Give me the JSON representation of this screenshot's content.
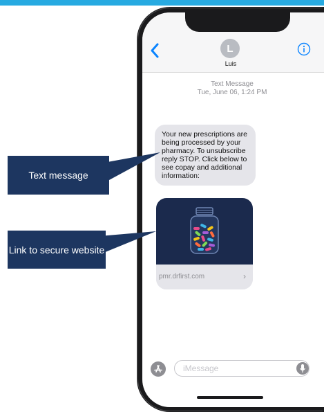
{
  "contact": {
    "initial": "L",
    "name": "Luis"
  },
  "conversation": {
    "type_label": "Text Message",
    "timestamp": "Tue, June 06, 1:24 PM",
    "message_text": "Your new prescriptions are being processed by your pharmacy. To unsubscribe reply STOP. Click below to see copay and additional information:",
    "link_url": "pmr.drfirst.com"
  },
  "composer": {
    "placeholder": "iMessage"
  },
  "callouts": {
    "text_message": "Text message",
    "secure_link": "Link to secure website"
  },
  "colors": {
    "top_bar": "#27aae1",
    "callout_bg": "#1d3660",
    "ios_blue": "#0a84ff",
    "bubble_gray": "#e5e5ea"
  }
}
